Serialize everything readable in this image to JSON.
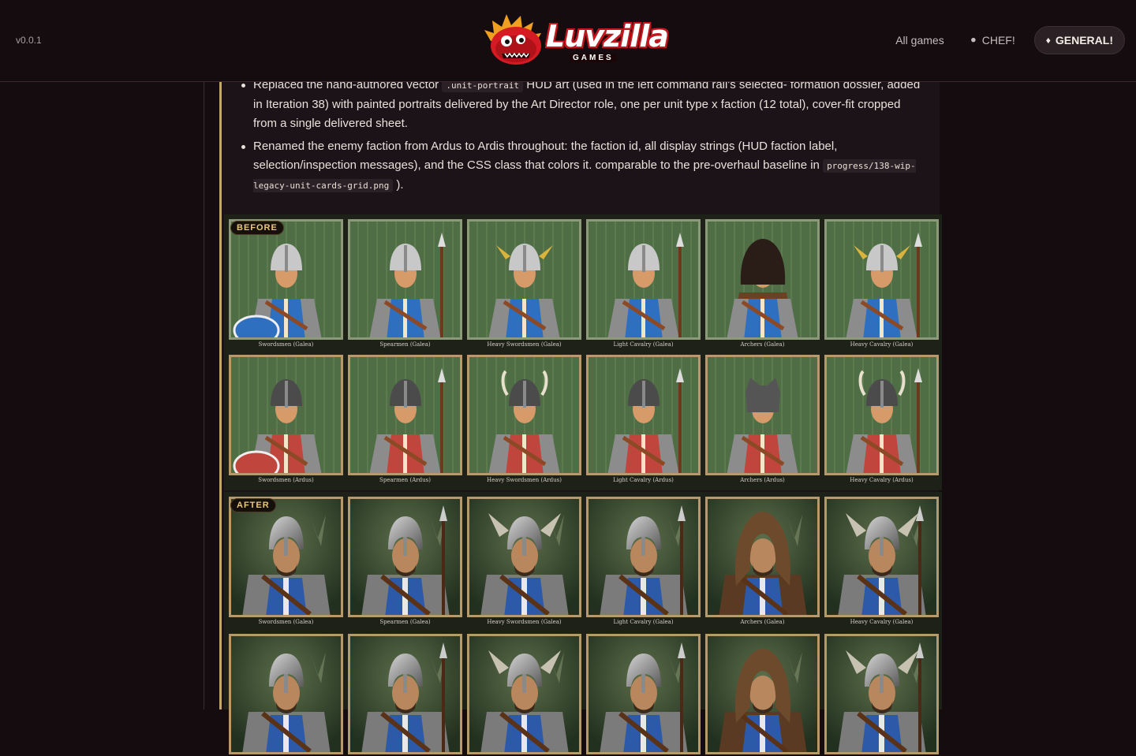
{
  "header": {
    "version": "v0.0.1",
    "logo": {
      "word": "Luvzilla",
      "sub": "GAMES"
    },
    "nav": {
      "all_games": "All games",
      "chef": "CHEF!",
      "general": "GENERAL!"
    }
  },
  "notes": {
    "item1_pre": "Replaced the hand-authored vector",
    "item1_code": ".unit-portrait",
    "item1_post": "HUD art (used in the left command rail's selected- formation dossier, added in Iteration 38) with painted portraits delivered by the Art Director role, one per unit type x faction (12 total), cover-fit cropped from a single delivered sheet.",
    "item2_pre": "Renamed the enemy faction from Ardus to Ardis throughout: the faction id, all display strings (HUD faction label, selection/inspection messages), and the CSS class that colors it. comparable to the pre-overhaul baseline in",
    "item2_code": "progress/138-wip-legacy-unit-cards-grid.png",
    "item2_post": ")."
  },
  "before": {
    "tag": "BEFORE",
    "row1": [
      "Swordsmen (Galea)",
      "Spearmen (Galea)",
      "Heavy Swordsmen (Galea)",
      "Light Cavalry (Galea)",
      "Archers (Galea)",
      "Heavy Cavalry (Galea)"
    ],
    "row2": [
      "Swordsmen (Ardus)",
      "Spearmen (Ardus)",
      "Heavy Swordsmen (Ardus)",
      "Light Cavalry (Ardus)",
      "Archers (Ardus)",
      "Heavy Cavalry (Ardus)"
    ]
  },
  "after": {
    "tag": "AFTER",
    "row1": [
      "Swordsmen (Galea)",
      "Spearmen (Galea)",
      "Heavy Swordsmen (Galea)",
      "Light Cavalry (Galea)",
      "Archers (Galea)",
      "Heavy Cavalry (Galea)"
    ]
  },
  "colors": {
    "accent_gold": "#c9a46a",
    "galea_blue": "#2f6fc0",
    "ardus_red": "#c0453d",
    "portrait_green": "#4a6a3f"
  }
}
